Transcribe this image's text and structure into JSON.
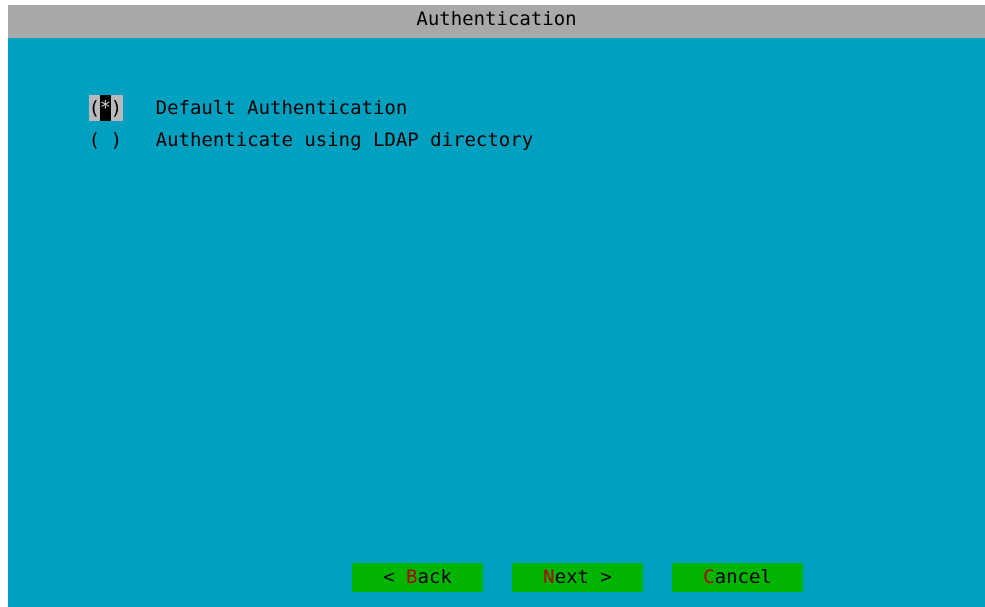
{
  "dialog": {
    "title": "Authentication"
  },
  "options": [
    {
      "paren_open": "(",
      "mark": "*",
      "paren_close": ")",
      "label": "Default Authentication",
      "selected": true
    },
    {
      "paren_open": "(",
      "mark": " ",
      "paren_close": ")",
      "label": "Authenticate using LDAP directory",
      "selected": false
    }
  ],
  "buttons": {
    "back": {
      "prefix": "< ",
      "hotkey": "B",
      "rest": "ack"
    },
    "next": {
      "prefix": "",
      "hotkey": "N",
      "rest": "ext >"
    },
    "cancel": {
      "prefix": "",
      "hotkey": "C",
      "rest": "ancel"
    }
  },
  "colors": {
    "dialog_background": "#00a0c0",
    "title_bar": "#a8a8a8",
    "button_background": "#00b400",
    "hotkey": "#b00000"
  }
}
